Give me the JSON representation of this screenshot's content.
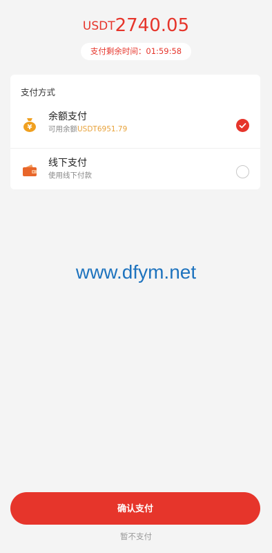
{
  "header": {
    "currency": "USDT",
    "amount": "2740.05",
    "timer_label": "支付剩余时间：",
    "timer_value": "01:59:58"
  },
  "payment_card": {
    "title": "支付方式",
    "options": [
      {
        "title": "余额支付",
        "subtitle_prefix": "可用余额",
        "subtitle_highlight": "USDT6951.79",
        "icon": "money-bag-icon",
        "selected": true
      },
      {
        "title": "线下支付",
        "subtitle": "使用线下付款",
        "icon": "wallet-icon",
        "selected": false
      }
    ]
  },
  "watermark": "www.dfym.net",
  "footer": {
    "confirm_label": "确认支付",
    "skip_label": "暂不支付"
  },
  "colors": {
    "accent": "#e6352b",
    "highlight": "#e8a23a",
    "icon_orange": "#f0a020",
    "wallet_orange": "#e8662a",
    "watermark": "#1e73be"
  }
}
